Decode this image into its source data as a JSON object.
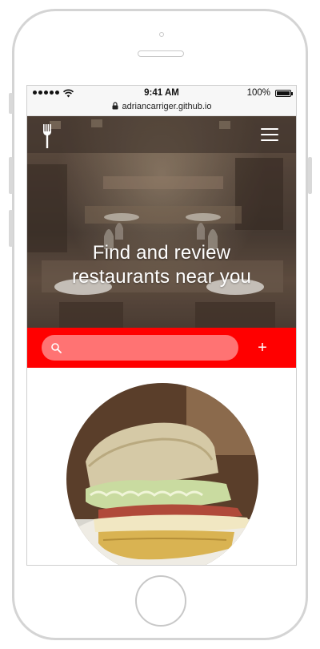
{
  "status_bar": {
    "time": "9:41 AM",
    "battery": "100%"
  },
  "browser": {
    "url": "adriancarriger.github.io"
  },
  "header": {
    "logo_icon": "fork-icon",
    "menu_icon": "hamburger-menu-icon",
    "title_line1": "Find and review",
    "title_line2": "restaurants near you"
  },
  "search": {
    "placeholder": "",
    "value": "",
    "add_label": "+"
  },
  "colors": {
    "accent": "#ff0000",
    "search_field": "#ff7373"
  },
  "photo": {
    "subject": "sandwich"
  }
}
